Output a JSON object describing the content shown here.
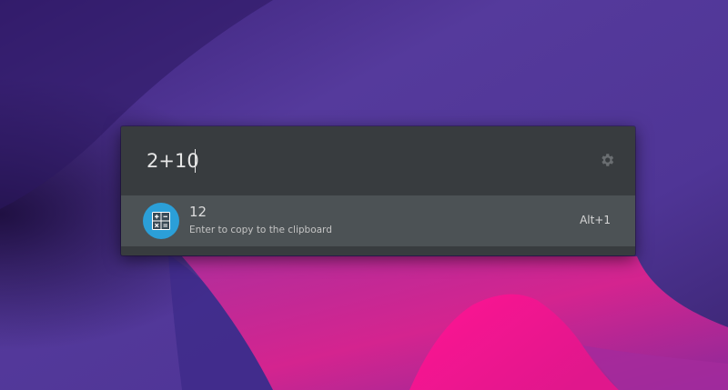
{
  "launcher": {
    "query": "2+10",
    "preferences_icon": "gear-icon"
  },
  "results": [
    {
      "icon": "calculator-icon",
      "title": "12",
      "description": "Enter to copy to the clipboard",
      "shortcut": "Alt+1"
    }
  ],
  "colors": {
    "panel_bg": "#383c3f",
    "selected_row_bg": "#4c5255",
    "text": "#e6e6e6",
    "calculator_accent": "#2b9fd8"
  }
}
